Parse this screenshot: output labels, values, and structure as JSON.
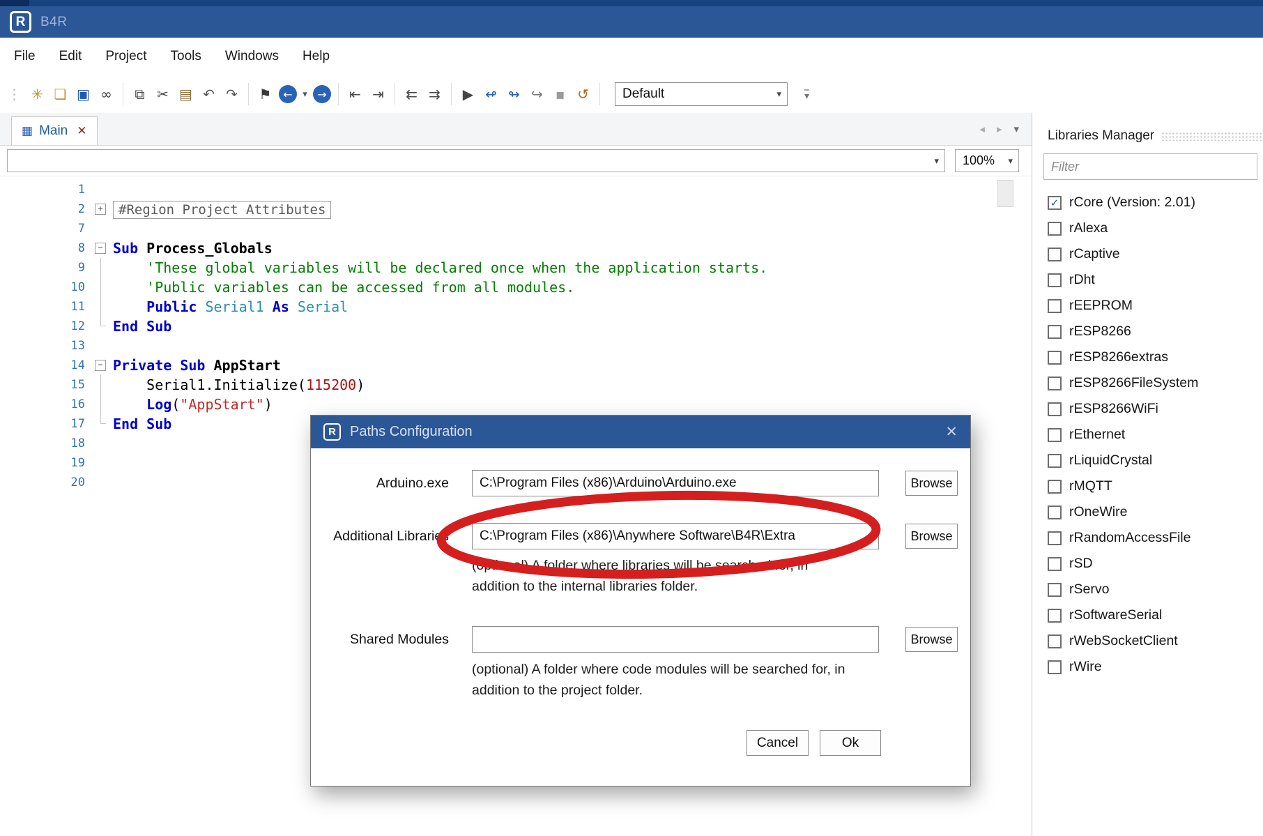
{
  "window": {
    "app_title": "B4R"
  },
  "glyphs": {
    "logo_letter": "R",
    "caret_down": "▾",
    "tab_icon": "▦",
    "tab_close": "✕",
    "nav_left": "◂",
    "nav_right": "▸",
    "check": "✓",
    "dialog_close": "✕",
    "fold_open": "−",
    "fold_closed": "+"
  },
  "menu": {
    "items": [
      "File",
      "Edit",
      "Project",
      "Tools",
      "Windows",
      "Help"
    ]
  },
  "toolbar": {
    "profile": "Default",
    "items": [
      {
        "name": "toolbar-drag-handle-icon",
        "glyph": "⋮",
        "color": "#b4b4b4"
      },
      {
        "name": "new-file-icon",
        "glyph": "✳",
        "color": "#b8922a"
      },
      {
        "name": "open-project-icon",
        "glyph": "❏",
        "color": "#c7922e"
      },
      {
        "name": "save-icon",
        "glyph": "▣",
        "color": "#1f5bb5"
      },
      {
        "name": "find-icon",
        "glyph": "∞",
        "color": "#3a3a3a"
      },
      {
        "sep": true
      },
      {
        "name": "duplicate-icon",
        "glyph": "⧉",
        "color": "#4a4a4a"
      },
      {
        "name": "cut-icon",
        "glyph": "✂",
        "color": "#4a4a4a"
      },
      {
        "name": "paste-icon",
        "glyph": "▤",
        "color": "#8a6f3c"
      },
      {
        "name": "undo-icon",
        "glyph": "↶",
        "color": "#565656"
      },
      {
        "name": "redo-icon",
        "glyph": "↷",
        "color": "#565656"
      },
      {
        "sep": true
      },
      {
        "name": "bookmark-icon",
        "glyph": "⚑",
        "color": "#3a3a3a"
      },
      {
        "name": "navigate-back-icon",
        "glyph": "←",
        "color": "#ffffff",
        "bg": "#2a62b8"
      },
      {
        "name": "navigate-back-caret-icon",
        "glyph": "▾",
        "color": "#555555",
        "small": true
      },
      {
        "name": "navigate-forward-icon",
        "glyph": "→",
        "color": "#ffffff",
        "bg": "#2a62b8"
      },
      {
        "sep": true
      },
      {
        "name": "indent-decrease-icon",
        "glyph": "⇤",
        "color": "#4a4a4a"
      },
      {
        "name": "indent-increase-icon",
        "glyph": "⇥",
        "color": "#4a4a4a"
      },
      {
        "sep": true
      },
      {
        "name": "comment-icon",
        "glyph": "⇇",
        "color": "#4a4a4a"
      },
      {
        "name": "uncomment-icon",
        "glyph": "⇉",
        "color": "#4a4a4a"
      },
      {
        "sep": true
      },
      {
        "name": "run-icon",
        "glyph": "▶",
        "color": "#444444"
      },
      {
        "name": "goto-previous-icon",
        "glyph": "↫",
        "color": "#2a62b8"
      },
      {
        "name": "goto-next-icon",
        "glyph": "↬",
        "color": "#2a62b8"
      },
      {
        "name": "jump-icon",
        "glyph": "↪",
        "color": "#7a7a7a"
      },
      {
        "name": "stop-icon",
        "glyph": "▪",
        "color": "#9a9a9a"
      },
      {
        "name": "rebuild-icon",
        "glyph": "↺",
        "color": "#b06a1e"
      },
      {
        "sep": true
      }
    ]
  },
  "tabs": {
    "main_label": "Main"
  },
  "editor": {
    "zoom": "100%",
    "lines": [
      {
        "n": "1",
        "fold": "",
        "seg": []
      },
      {
        "n": "2",
        "fold": "plus",
        "seg": [
          {
            "t": "#Region Project Attributes",
            "s": "region"
          }
        ]
      },
      {
        "n": "7",
        "fold": "",
        "seg": []
      },
      {
        "n": "8",
        "fold": "minus",
        "seg": [
          {
            "t": "Sub ",
            "s": "kw"
          },
          {
            "t": "Process_Globals",
            "s": "id"
          }
        ]
      },
      {
        "n": "9",
        "fold": "v",
        "seg": [
          {
            "t": "    ",
            "s": "pl"
          },
          {
            "t": "'These global variables will be declared once when the application starts.",
            "s": "cm"
          }
        ]
      },
      {
        "n": "10",
        "fold": "v",
        "seg": [
          {
            "t": "    ",
            "s": "pl"
          },
          {
            "t": "'Public variables can be accessed from all modules.",
            "s": "cm"
          }
        ]
      },
      {
        "n": "11",
        "fold": "v",
        "seg": [
          {
            "t": "    ",
            "s": "pl"
          },
          {
            "t": "Public ",
            "s": "kw"
          },
          {
            "t": "Serial1 ",
            "s": "ty"
          },
          {
            "t": "As ",
            "s": "kw"
          },
          {
            "t": "Serial",
            "s": "ty"
          }
        ]
      },
      {
        "n": "12",
        "fold": "end",
        "seg": [
          {
            "t": "End Sub",
            "s": "kw"
          }
        ]
      },
      {
        "n": "13",
        "fold": "",
        "seg": []
      },
      {
        "n": "14",
        "fold": "minus",
        "seg": [
          {
            "t": "Private Sub ",
            "s": "kw"
          },
          {
            "t": "AppStart",
            "s": "id"
          }
        ]
      },
      {
        "n": "15",
        "fold": "v",
        "seg": [
          {
            "t": "    ",
            "s": "pl"
          },
          {
            "t": "Serial1.Initialize(",
            "s": "pl"
          },
          {
            "t": "115200",
            "s": "num"
          },
          {
            "t": ")",
            "s": "pl"
          }
        ]
      },
      {
        "n": "16",
        "fold": "v",
        "seg": [
          {
            "t": "    ",
            "s": "pl"
          },
          {
            "t": "Log",
            "s": "kw"
          },
          {
            "t": "(",
            "s": "pl"
          },
          {
            "t": "\"AppStart\"",
            "s": "str"
          },
          {
            "t": ")",
            "s": "pl"
          }
        ]
      },
      {
        "n": "17",
        "fold": "end",
        "seg": [
          {
            "t": "End Sub",
            "s": "kw"
          }
        ]
      },
      {
        "n": "18",
        "fold": "",
        "seg": []
      },
      {
        "n": "19",
        "fold": "",
        "seg": []
      },
      {
        "n": "20",
        "fold": "",
        "seg": []
      }
    ]
  },
  "libraries": {
    "title": "Libraries Manager",
    "filter_placeholder": "Filter",
    "items": [
      {
        "label": "rCore (Version: 2.01)",
        "checked": true
      },
      {
        "label": "rAlexa",
        "checked": false
      },
      {
        "label": "rCaptive",
        "checked": false
      },
      {
        "label": "rDht",
        "checked": false
      },
      {
        "label": "rEEPROM",
        "checked": false
      },
      {
        "label": "rESP8266",
        "checked": false
      },
      {
        "label": "rESP8266extras",
        "checked": false
      },
      {
        "label": "rESP8266FileSystem",
        "checked": false
      },
      {
        "label": "rESP8266WiFi",
        "checked": false
      },
      {
        "label": "rEthernet",
        "checked": false
      },
      {
        "label": "rLiquidCrystal",
        "checked": false
      },
      {
        "label": "rMQTT",
        "checked": false
      },
      {
        "label": "rOneWire",
        "checked": false
      },
      {
        "label": "rRandomAccessFile",
        "checked": false
      },
      {
        "label": "rSD",
        "checked": false
      },
      {
        "label": "rServo",
        "checked": false
      },
      {
        "label": "rSoftwareSerial",
        "checked": false
      },
      {
        "label": "rWebSocketClient",
        "checked": false
      },
      {
        "label": "rWire",
        "checked": false
      }
    ]
  },
  "dialog": {
    "title": "Paths Configuration",
    "browse_label": "Browse",
    "cancel_label": "Cancel",
    "ok_label": "Ok",
    "fields": [
      {
        "label": "Arduino.exe",
        "value": "C:\\Program Files (x86)\\Arduino\\Arduino.exe"
      },
      {
        "label": "Additional Libraries",
        "value": "C:\\Program Files (x86)\\Anywhere Software\\B4R\\Extra",
        "hint": "(optional) A folder where libraries will be searched for, in addition to the internal libraries folder."
      },
      {
        "label": "Shared Modules",
        "value": "",
        "hint": "(optional) A folder where code modules will be searched for, in addition to the project folder."
      }
    ]
  },
  "annotation": {
    "color": "#d51f1f"
  }
}
